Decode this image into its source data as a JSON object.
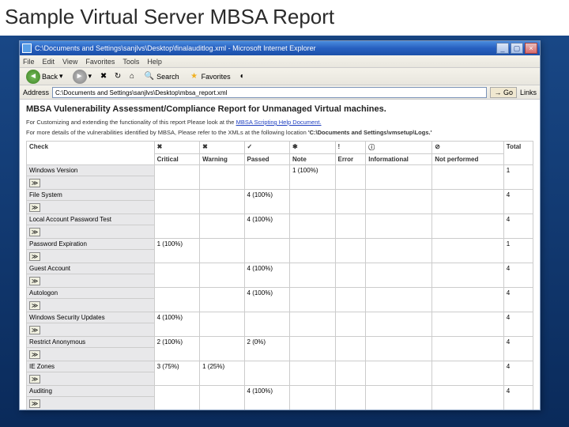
{
  "slide": {
    "title": "Sample Virtual Server MBSA Report"
  },
  "window": {
    "title": "C:\\Documents and Settings\\sanjlvs\\Desktop\\finalauditlog.xml - Microsoft Internet Explorer",
    "min": "_",
    "max": "▢",
    "close": "×"
  },
  "menu": {
    "file": "File",
    "edit": "Edit",
    "view": "View",
    "favorites": "Favorites",
    "tools": "Tools",
    "help": "Help"
  },
  "toolbar": {
    "back": "Back",
    "search": "Search",
    "favorites": "Favorites"
  },
  "address": {
    "label": "Address",
    "value": "C:\\Documents and Settings\\sanjlvs\\Desktop\\mbsa_report.xml",
    "go": "Go",
    "links": "Links"
  },
  "report": {
    "title": "MBSA Vulenerability Assessment/Compliance Report for Unmanaged Virtual machines.",
    "sub1_a": "For Customizing and extending the functionality of this report Please look at the ",
    "sub1_link": "MBSA Scripting Help Document.",
    "sub2_a": "For more details of the vulnerabilities identified by MBSA, Please refer to the XMLs at the following location ",
    "sub2_b": "'C:\\Documents and Settings\\vmsetup\\Logs.'"
  },
  "columns": {
    "check": "Check",
    "critical": "Critical",
    "warning": "Warning",
    "passed": "Passed",
    "note": "Note",
    "error": "Error",
    "informational": "Informational",
    "notperformed": "Not performed",
    "total": "Total"
  },
  "icons": {
    "critical": "✖",
    "warning": "✖",
    "passed": "✓",
    "note": "✱",
    "error": "!",
    "info": "ⓘ",
    "np": "⊘"
  },
  "rows": [
    {
      "name": "Windows Version",
      "note": "1\n(100%)",
      "total": "1"
    },
    {
      "name": "File System",
      "passed": "4\n(100%)",
      "total": "4"
    },
    {
      "name": "Local Account Password Test",
      "passed": "4\n(100%)",
      "total": "4"
    },
    {
      "name": "Password Expiration",
      "critical": "1 (100%)",
      "total": "1"
    },
    {
      "name": "Guest Account",
      "passed": "4\n(100%)",
      "total": "4"
    },
    {
      "name": "Autologon",
      "passed": "4\n(100%)",
      "total": "4"
    },
    {
      "name": "Windows Security Updates",
      "critical": "4\n(100%)",
      "total": "4"
    },
    {
      "name": "Restrict Anonymous",
      "critical": "2 (100%)",
      "passed": "2 (0%)",
      "total": "4"
    },
    {
      "name": "IE Zones",
      "critical": "3 (75%)",
      "warning": "1 (25%)",
      "total": "4"
    },
    {
      "name": "Auditing",
      "passed": "4\n(100%)",
      "total": "4"
    }
  ],
  "expand": "≫"
}
